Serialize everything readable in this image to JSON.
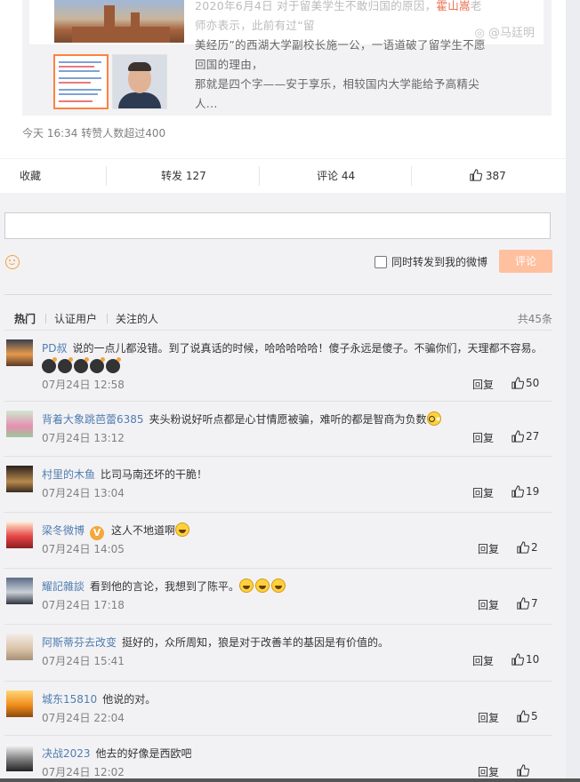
{
  "repost_preview": {
    "snippet_line0": "2020年6月4日 对于留美学生不敢归国的原因，",
    "snippet_line0_mention": "霍山嵩",
    "snippet_line0_rest": "老师亦表示，此前有过",
    "snippet_line0_quote": "“留",
    "snippet_line1": "美经历”的西湖大学副校长施一公，一语道破了留学生不愿回国的理由，",
    "snippet_line2": "那就是四个字——安于享乐，相较国内大学能给予高精尖人...",
    "watermark": "@马廷明"
  },
  "post_meta": "今天 16:34 转赞人数超过400",
  "action_bar": {
    "favorite": "收藏",
    "repost": "转发 127",
    "comment": "评论 44",
    "like": "387"
  },
  "composer": {
    "repost_checkbox_label": "同时转发到我的微博",
    "submit_label": "评论"
  },
  "comment_tabs": {
    "hot": "热门",
    "verified": "认证用户",
    "following": "关注的人",
    "total": "共45条"
  },
  "labels": {
    "reply": "回复"
  },
  "comments": [
    {
      "user": "PD叔",
      "text": "说的一点儿都没错。到了说真话的时候，哈哈哈哈哈！傻子永远是傻子。不骗你们，天理都不容易。",
      "time": "07月24日 12:58",
      "likes": "50",
      "emoji": "bomb",
      "emoji_count": 5
    },
    {
      "user": "背着大象跳芭蕾6385",
      "text": "夹头粉说好听点都是心甘情愿被骗，难听的都是智商为负数",
      "time": "07月24日 13:12",
      "likes": "27",
      "emoji": "glasses",
      "emoji_count": 1
    },
    {
      "user": "村里的木鱼",
      "text": "比司马南还坏的干脆！",
      "time": "07月24日 13:04",
      "likes": "19",
      "emoji": "",
      "emoji_count": 0
    },
    {
      "user": "梁冬微博",
      "text": "这人不地道啊",
      "time": "07月24日 14:05",
      "likes": "2",
      "emoji": "laugh",
      "emoji_count": 1,
      "verified": true
    },
    {
      "user": "耀記雜談",
      "text": "看到他的言论，我想到了陈平。",
      "time": "07月24日 17:18",
      "likes": "7",
      "emoji": "laugh",
      "emoji_count": 3
    },
    {
      "user": "阿斯蒂芬去改变",
      "text": "挺好的，众所周知，狼是对于改善羊的基因是有价值的。",
      "time": "07月24日 15:41",
      "likes": "10",
      "emoji": "",
      "emoji_count": 0
    },
    {
      "user": "城东15810",
      "text": "他说的对。",
      "time": "07月24日 22:04",
      "likes": "5",
      "emoji": "",
      "emoji_count": 0
    },
    {
      "user": "决战2023",
      "text": "他去的好像是西欧吧",
      "time": "07月24日 12:02",
      "likes": "",
      "emoji": "",
      "emoji_count": 0
    }
  ]
}
